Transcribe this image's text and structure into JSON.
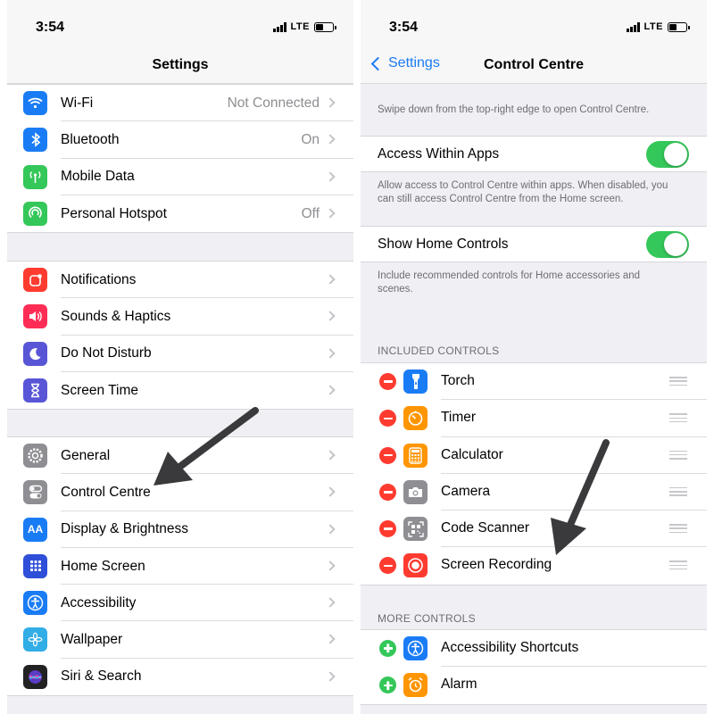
{
  "status": {
    "time": "3:54",
    "network": "LTE"
  },
  "left": {
    "title": "Settings",
    "group1": [
      {
        "label": "Wi-Fi",
        "value": "Not Connected",
        "icon": "wifi-icon",
        "color": "#1a7cf5"
      },
      {
        "label": "Bluetooth",
        "value": "On",
        "icon": "bluetooth-icon",
        "color": "#1a7cf5"
      },
      {
        "label": "Mobile Data",
        "value": "",
        "icon": "antenna-icon",
        "color": "#34c759"
      },
      {
        "label": "Personal Hotspot",
        "value": "Off",
        "icon": "hotspot-icon",
        "color": "#34c759"
      }
    ],
    "group2": [
      {
        "label": "Notifications",
        "icon": "notifications-icon",
        "color": "#ff3b30"
      },
      {
        "label": "Sounds & Haptics",
        "icon": "speaker-icon",
        "color": "#ff2d55"
      },
      {
        "label": "Do Not Disturb",
        "icon": "moon-icon",
        "color": "#5856d6"
      },
      {
        "label": "Screen Time",
        "icon": "hourglass-icon",
        "color": "#5856d6"
      }
    ],
    "group3": [
      {
        "label": "General",
        "icon": "gear-icon",
        "color": "#8e8e93"
      },
      {
        "label": "Control Centre",
        "icon": "toggles-icon",
        "color": "#8e8e93"
      },
      {
        "label": "Display & Brightness",
        "icon": "display-icon",
        "color": "#1a7cf5"
      },
      {
        "label": "Home Screen",
        "icon": "home-screen-icon",
        "color": "#2f4fd8"
      },
      {
        "label": "Accessibility",
        "icon": "accessibility-icon",
        "color": "#1a7cf5"
      },
      {
        "label": "Wallpaper",
        "icon": "flower-icon",
        "color": "#32ade6"
      },
      {
        "label": "Siri & Search",
        "icon": "siri-icon",
        "color": "#222222"
      }
    ]
  },
  "right": {
    "back": "Settings",
    "title": "Control Centre",
    "swipe_note": "Swipe down from the top-right edge to open Control Centre.",
    "access_label": "Access Within Apps",
    "access_note": "Allow access to Control Centre within apps. When disabled, you can still access Control Centre from the Home screen.",
    "home_label": "Show Home Controls",
    "home_note": "Include recommended controls for Home accessories and scenes.",
    "included_header": "INCLUDED CONTROLS",
    "included": [
      {
        "label": "Torch",
        "icon": "torch-icon",
        "color": "#1a7cf5"
      },
      {
        "label": "Timer",
        "icon": "timer-icon",
        "color": "#ff9500"
      },
      {
        "label": "Calculator",
        "icon": "calculator-icon",
        "color": "#ff9500"
      },
      {
        "label": "Camera",
        "icon": "camera-icon",
        "color": "#8e8e93"
      },
      {
        "label": "Code Scanner",
        "icon": "qr-scanner-icon",
        "color": "#8e8e93"
      },
      {
        "label": "Screen Recording",
        "icon": "record-icon",
        "color": "#ff3b30"
      }
    ],
    "more_header": "MORE CONTROLS",
    "more": [
      {
        "label": "Accessibility Shortcuts",
        "icon": "accessibility-icon",
        "color": "#1a7cf5"
      },
      {
        "label": "Alarm",
        "icon": "alarm-icon",
        "color": "#ff9500"
      }
    ]
  },
  "colors": {
    "accent": "#1a7cf5",
    "toggle_on": "#34c759",
    "remove": "#ff3b30",
    "add": "#34c759"
  }
}
